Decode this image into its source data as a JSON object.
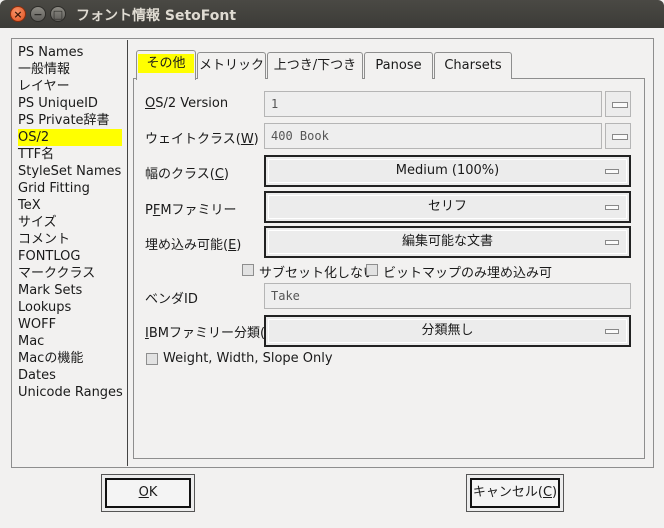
{
  "window": {
    "title": "フォント情報 SetoFont"
  },
  "sidebar": {
    "items": [
      {
        "label": "PS Names"
      },
      {
        "label": "一般情報"
      },
      {
        "label": "レイヤー"
      },
      {
        "label": "PS UniqueID"
      },
      {
        "label": "PS Private辞書"
      },
      {
        "label": "OS/2",
        "selected": true
      },
      {
        "label": "TTF名"
      },
      {
        "label": "StyleSet Names"
      },
      {
        "label": "Grid Fitting"
      },
      {
        "label": "TeX"
      },
      {
        "label": "サイズ"
      },
      {
        "label": "コメント"
      },
      {
        "label": "FONTLOG"
      },
      {
        "label": "マーククラス"
      },
      {
        "label": "Mark Sets"
      },
      {
        "label": "Lookups"
      },
      {
        "label": "WOFF"
      },
      {
        "label": "Mac"
      },
      {
        "label": "Macの機能"
      },
      {
        "label": "Dates"
      },
      {
        "label": "Unicode Ranges"
      }
    ]
  },
  "tabs": [
    {
      "label": "その他",
      "active": true
    },
    {
      "label": "メトリック"
    },
    {
      "label": "上つき/下つき"
    },
    {
      "label": "Panose"
    },
    {
      "label": "Charsets"
    }
  ],
  "form": {
    "os2_version": {
      "label_pre": "",
      "label_u": "O",
      "label_post": "S/2 Version",
      "value": "1"
    },
    "weight_class": {
      "label_pre": "ウェイトクラス(",
      "label_u": "W",
      "label_post": ")",
      "value": "400 Book"
    },
    "width_class": {
      "label_pre": "幅のクラス(",
      "label_u": "C",
      "label_post": ")",
      "value": "Medium (100%)"
    },
    "pfm_family": {
      "label_pre": "P",
      "label_u": "F",
      "label_post": "Mファミリー",
      "value": "セリフ"
    },
    "embeddable": {
      "label_pre": "埋め込み可能(",
      "label_u": "E",
      "label_post": ")",
      "value": "編集可能な文書"
    },
    "no_subset": {
      "label": "サブセット化しない",
      "checked": false
    },
    "bitmap_only": {
      "label": "ビットマップのみ埋め込み可",
      "checked": false
    },
    "vendor_id": {
      "label": "ベンダID",
      "value": "Take"
    },
    "ibm_family": {
      "label_pre": "",
      "label_u": "I",
      "label_post": "BMファミリー分類(I)",
      "value": "分類無し"
    },
    "wws_only": {
      "label": "Weight, Width, Slope Only",
      "checked": false
    }
  },
  "buttons": {
    "ok": {
      "label_u": "O",
      "label_post": "K"
    },
    "cancel": {
      "label_pre": "キャンセル(",
      "label_u": "C",
      "label_post": ")"
    }
  }
}
